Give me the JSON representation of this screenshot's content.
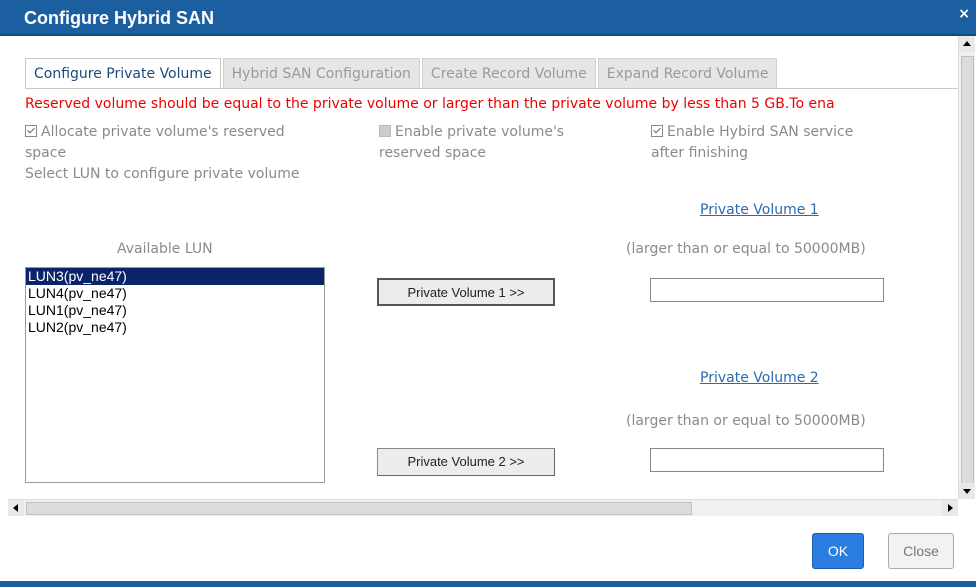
{
  "dialog": {
    "title": "Configure Hybrid SAN",
    "close_glyph": "×"
  },
  "tabs": [
    {
      "label": "Configure Private Volume",
      "active": true
    },
    {
      "label": "Hybrid SAN Configuration",
      "active": false
    },
    {
      "label": "Create Record Volume",
      "active": false
    },
    {
      "label": "Expand Record Volume",
      "active": false
    }
  ],
  "warning": "Reserved volume should be equal to the private volume or larger than the private volume by less than 5 GB.To ena",
  "options": {
    "allocate": {
      "line1": "Allocate private volume's reserved",
      "line2": "space",
      "checked": true,
      "enabled": true
    },
    "enable_reserved": {
      "line1": "Enable private volume's",
      "line2": "reserved space",
      "checked": false,
      "enabled": false
    },
    "enable_hybrid": {
      "line1": "Enable Hybird SAN service",
      "line2": "after finishing",
      "checked": true,
      "enabled": true
    }
  },
  "select_label": "Select LUN to configure private volume",
  "available_lun_label": "Available LUN",
  "luns": [
    {
      "label": "LUN3(pv_ne47)",
      "selected": true
    },
    {
      "label": "LUN4(pv_ne47)",
      "selected": false
    },
    {
      "label": "LUN1(pv_ne47)",
      "selected": false
    },
    {
      "label": "LUN2(pv_ne47)",
      "selected": false
    }
  ],
  "pv1": {
    "link": "Private Volume 1",
    "note": "(larger than or equal to 50000MB)",
    "button": "Private Volume 1 >>",
    "value": ""
  },
  "pv2": {
    "link": "Private Volume 2",
    "note": "(larger than or equal to 50000MB)",
    "button": "Private Volume 2 >>",
    "value": ""
  },
  "buttons": {
    "ok": "OK",
    "close": "Close"
  },
  "colors": {
    "title_bar": "#1b5fa0",
    "warning": "#ee0000",
    "ok_button": "#2b7de0",
    "selected_item": "#0a246a",
    "link": "#2a6ab0"
  }
}
